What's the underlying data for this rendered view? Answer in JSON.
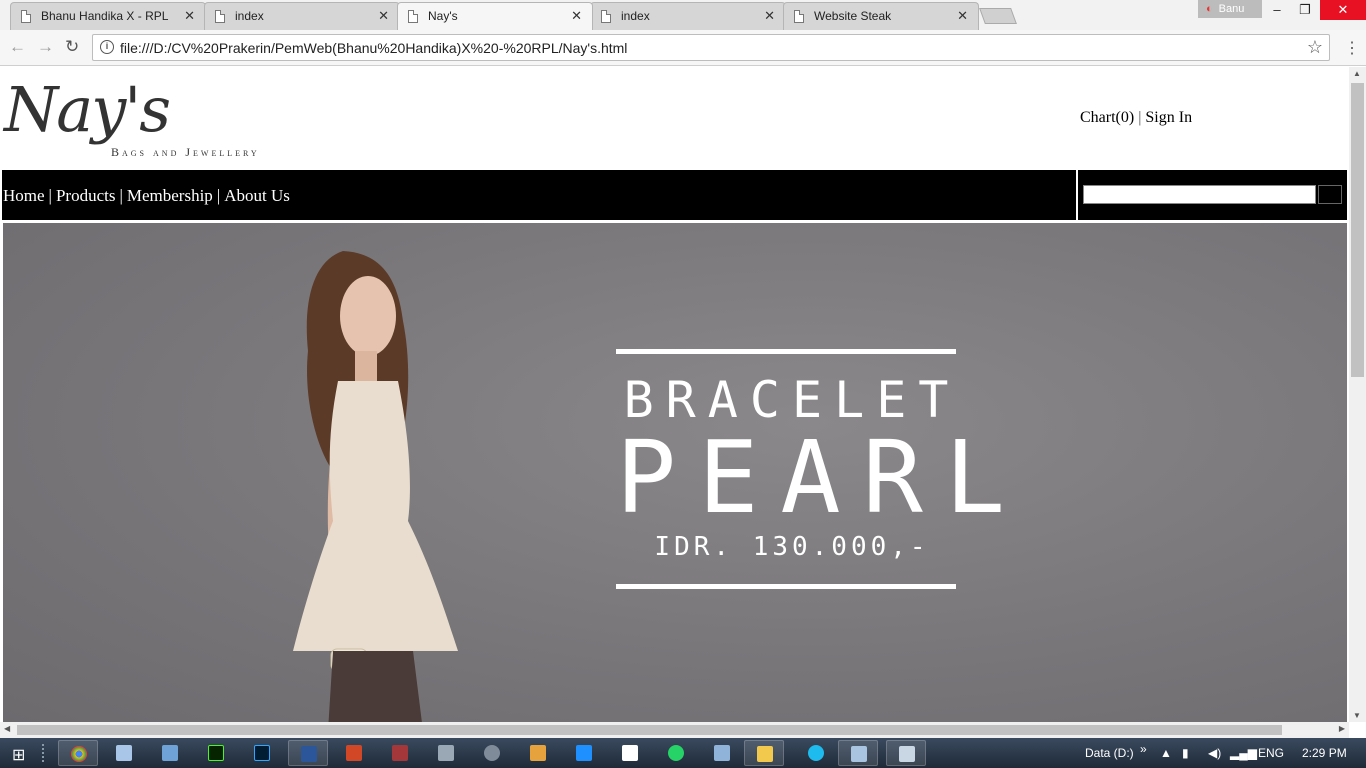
{
  "browser": {
    "tabs": [
      {
        "title": "Bhanu Handika X - RPL",
        "active": false
      },
      {
        "title": "index",
        "active": false
      },
      {
        "title": "Nay's",
        "active": true
      },
      {
        "title": "index",
        "active": false
      },
      {
        "title": "Website Steak",
        "active": false
      }
    ],
    "profile": "Banu",
    "url": "file:///D:/CV%20Prakerin/PemWeb(Bhanu%20Handika)X%20-%20RPL/Nay's.html"
  },
  "page": {
    "logo": {
      "script": "Nay's",
      "tagline": "Bags and Jewellery"
    },
    "toplinks": {
      "chart": "Chart(0)",
      "separator": "|",
      "signin": "Sign In"
    },
    "nav": {
      "items": [
        "Home",
        "Products",
        "Membership",
        "About Us"
      ],
      "separator": "|"
    },
    "search": {
      "placeholder": ""
    },
    "hero": {
      "line1": "BRACELET",
      "line2": "PEARL",
      "price": "IDR. 130.000,-"
    }
  },
  "taskbar": {
    "tray": {
      "drive": "Data (D:)",
      "lang": "ENG",
      "time": "2:29 PM"
    },
    "colors": {
      "start": "#ffffff",
      "accent": "#e81123"
    }
  }
}
